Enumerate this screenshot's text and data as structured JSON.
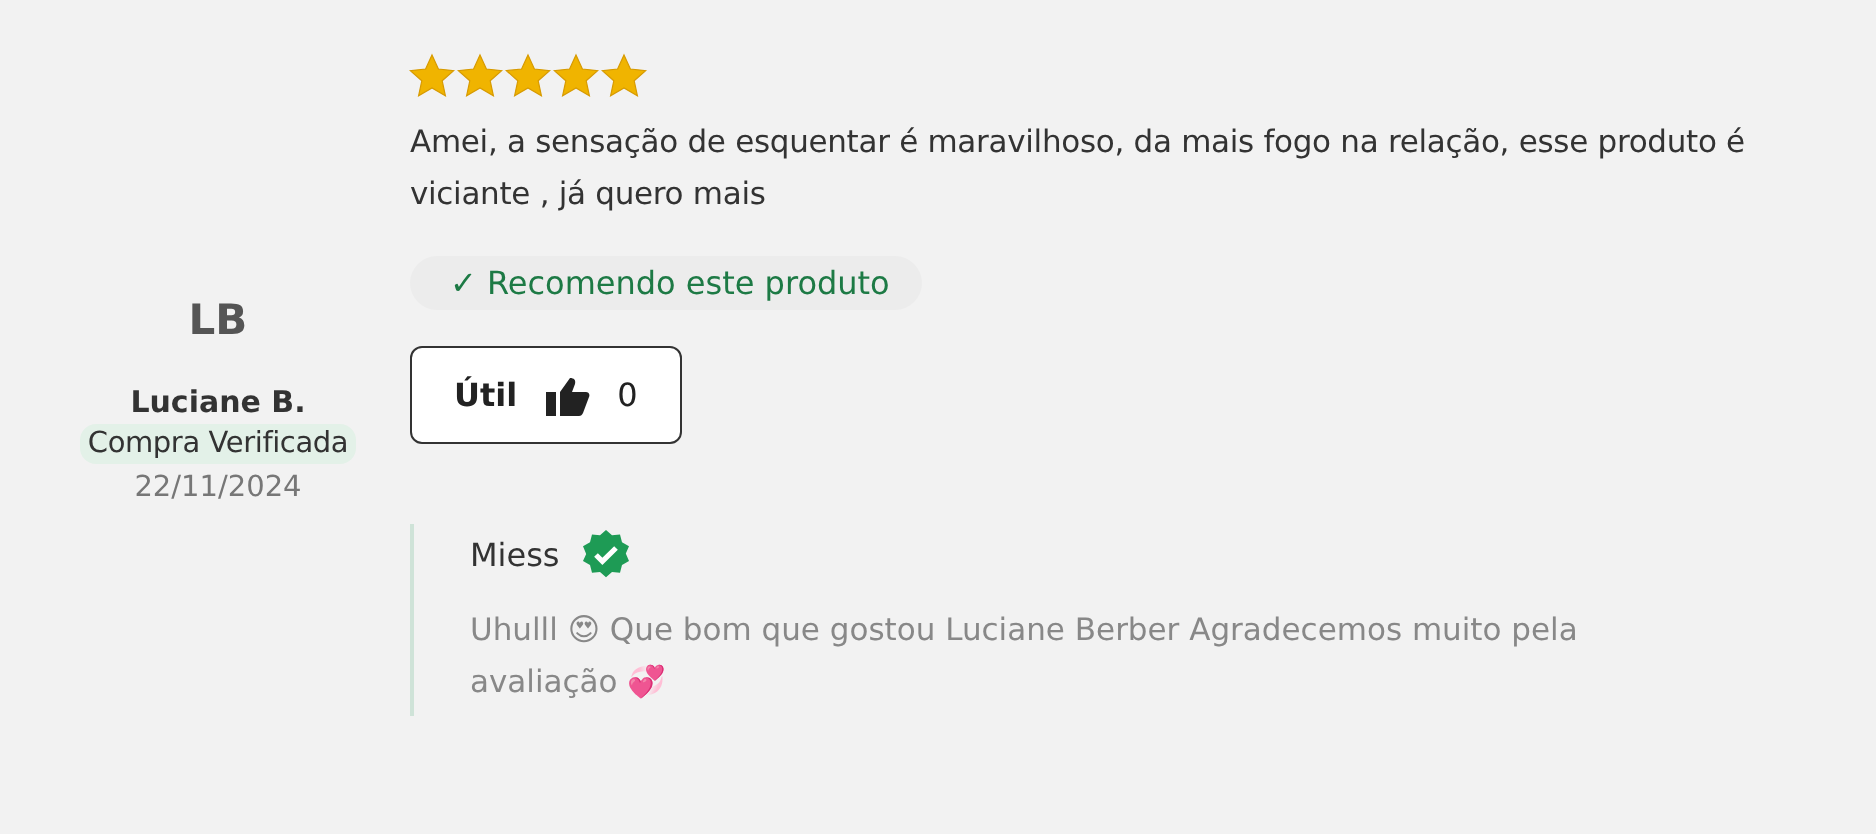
{
  "review": {
    "stars": 5,
    "text": "Amei, a sensação de esquentar é maravilhoso, da mais fogo na relação, esse produto é viciante , já quero mais",
    "recommend": "✓ Recomendo este produto",
    "helpful": {
      "label": "Útil",
      "count": "0"
    }
  },
  "author": {
    "initials": "LB",
    "name": "Luciane B.",
    "badge": "Compra Verificada",
    "date": "22/11/2024"
  },
  "reply": {
    "author": "Miess",
    "verified": true,
    "text": "Uhulll 😍 Que bom que gostou Luciane Berber Agradecemos muito pela avaliação 💞"
  }
}
